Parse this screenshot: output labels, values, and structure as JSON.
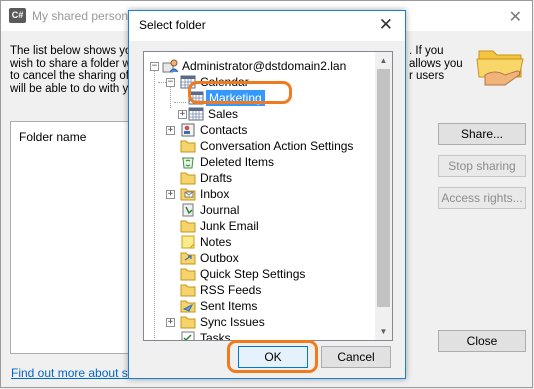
{
  "background_window": {
    "title": "My shared persona",
    "app_icon_text": "C#",
    "description_left": [
      "The list below shows you",
      "wish to share a folder wit",
      "to cancel the sharing of a",
      "will be able to do with yo"
    ],
    "description_right": [
      ". If you",
      "allows you",
      "r users",
      ""
    ],
    "list_column": "Folder name",
    "buttons": {
      "share": "Share...",
      "stop_sharing": "Stop sharing",
      "access_rights": "Access rights...",
      "close": "Close"
    },
    "link": "Find out more about sha"
  },
  "dialog": {
    "title": "Select folder",
    "ok_label": "OK",
    "cancel_label": "Cancel",
    "tree": {
      "root": "Administrator@dstdomain2.lan",
      "items": [
        {
          "label": "Calendar"
        },
        {
          "label": "Marketing",
          "selected": true
        },
        {
          "label": "Sales"
        },
        {
          "label": "Contacts"
        },
        {
          "label": "Conversation Action Settings"
        },
        {
          "label": "Deleted Items"
        },
        {
          "label": "Drafts"
        },
        {
          "label": "Inbox"
        },
        {
          "label": "Journal"
        },
        {
          "label": "Junk Email"
        },
        {
          "label": "Notes"
        },
        {
          "label": "Outbox"
        },
        {
          "label": "Quick Step Settings"
        },
        {
          "label": "RSS Feeds"
        },
        {
          "label": "Sent Items"
        },
        {
          "label": "Sync Issues"
        },
        {
          "label": "Tasks"
        }
      ]
    }
  },
  "colors": {
    "highlight": "#f07b1e",
    "selection": "#3399ff",
    "accent_border": "#1a7fd6",
    "link": "#0066cc"
  }
}
